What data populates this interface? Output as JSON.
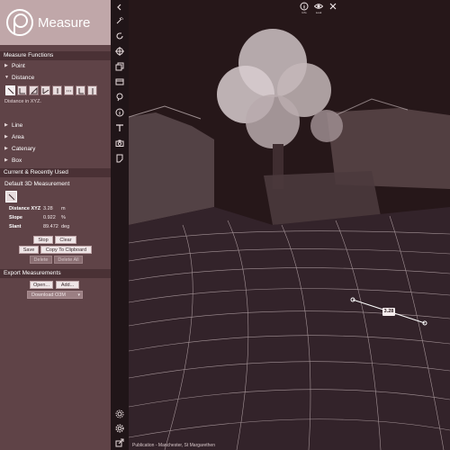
{
  "app": {
    "title": "Measure"
  },
  "panel": {
    "measure_functions": {
      "header": "Measure Functions",
      "items": [
        "Point",
        "Distance",
        "Line",
        "Area",
        "Catenary",
        "Box"
      ],
      "distance_hint": "Distance in XYZ."
    },
    "current": {
      "header": "Current & Recently Used",
      "default_label": "Default 3D Measurement",
      "stats": [
        {
          "label": "Distance XYZ",
          "value": "3.28",
          "unit": "m"
        },
        {
          "label": "Slope",
          "value": "0.922",
          "unit": "%"
        },
        {
          "label": "Slant",
          "value": "89.472",
          "unit": "deg"
        }
      ],
      "buttons": {
        "stop": "Stop",
        "clear": "Clear",
        "save": "Save",
        "copy": "Copy To Clipboard",
        "delete": "Delete",
        "delete_all": "Delete All"
      }
    },
    "export": {
      "header": "Export Measurements",
      "open": "Open...",
      "add": "Add...",
      "download": "Download O3M"
    }
  },
  "strip_icons": [
    "chevron-left-icon",
    "magic-wand-icon",
    "rotate-icon",
    "crosshair-icon",
    "layers-icon",
    "panel-icon",
    "pin-icon",
    "info-icon",
    "tag-icon",
    "camera-icon",
    "note-icon",
    "settings-icon",
    "gear-icon",
    "export-icon"
  ],
  "viewport": {
    "top_icons": [
      {
        "name": "info-icon",
        "caption": "Info"
      },
      {
        "name": "eye-icon",
        "caption": "Look"
      },
      {
        "name": "close-icon",
        "caption": ""
      }
    ],
    "measure_label": "3.28",
    "footer": "Publication - Manchester, St Margarethen"
  },
  "colors": {
    "panel": "#5f4347",
    "logo_bar": "#c0a7a9",
    "section_header": "#4a3135",
    "viewport_bg": "#261719"
  }
}
